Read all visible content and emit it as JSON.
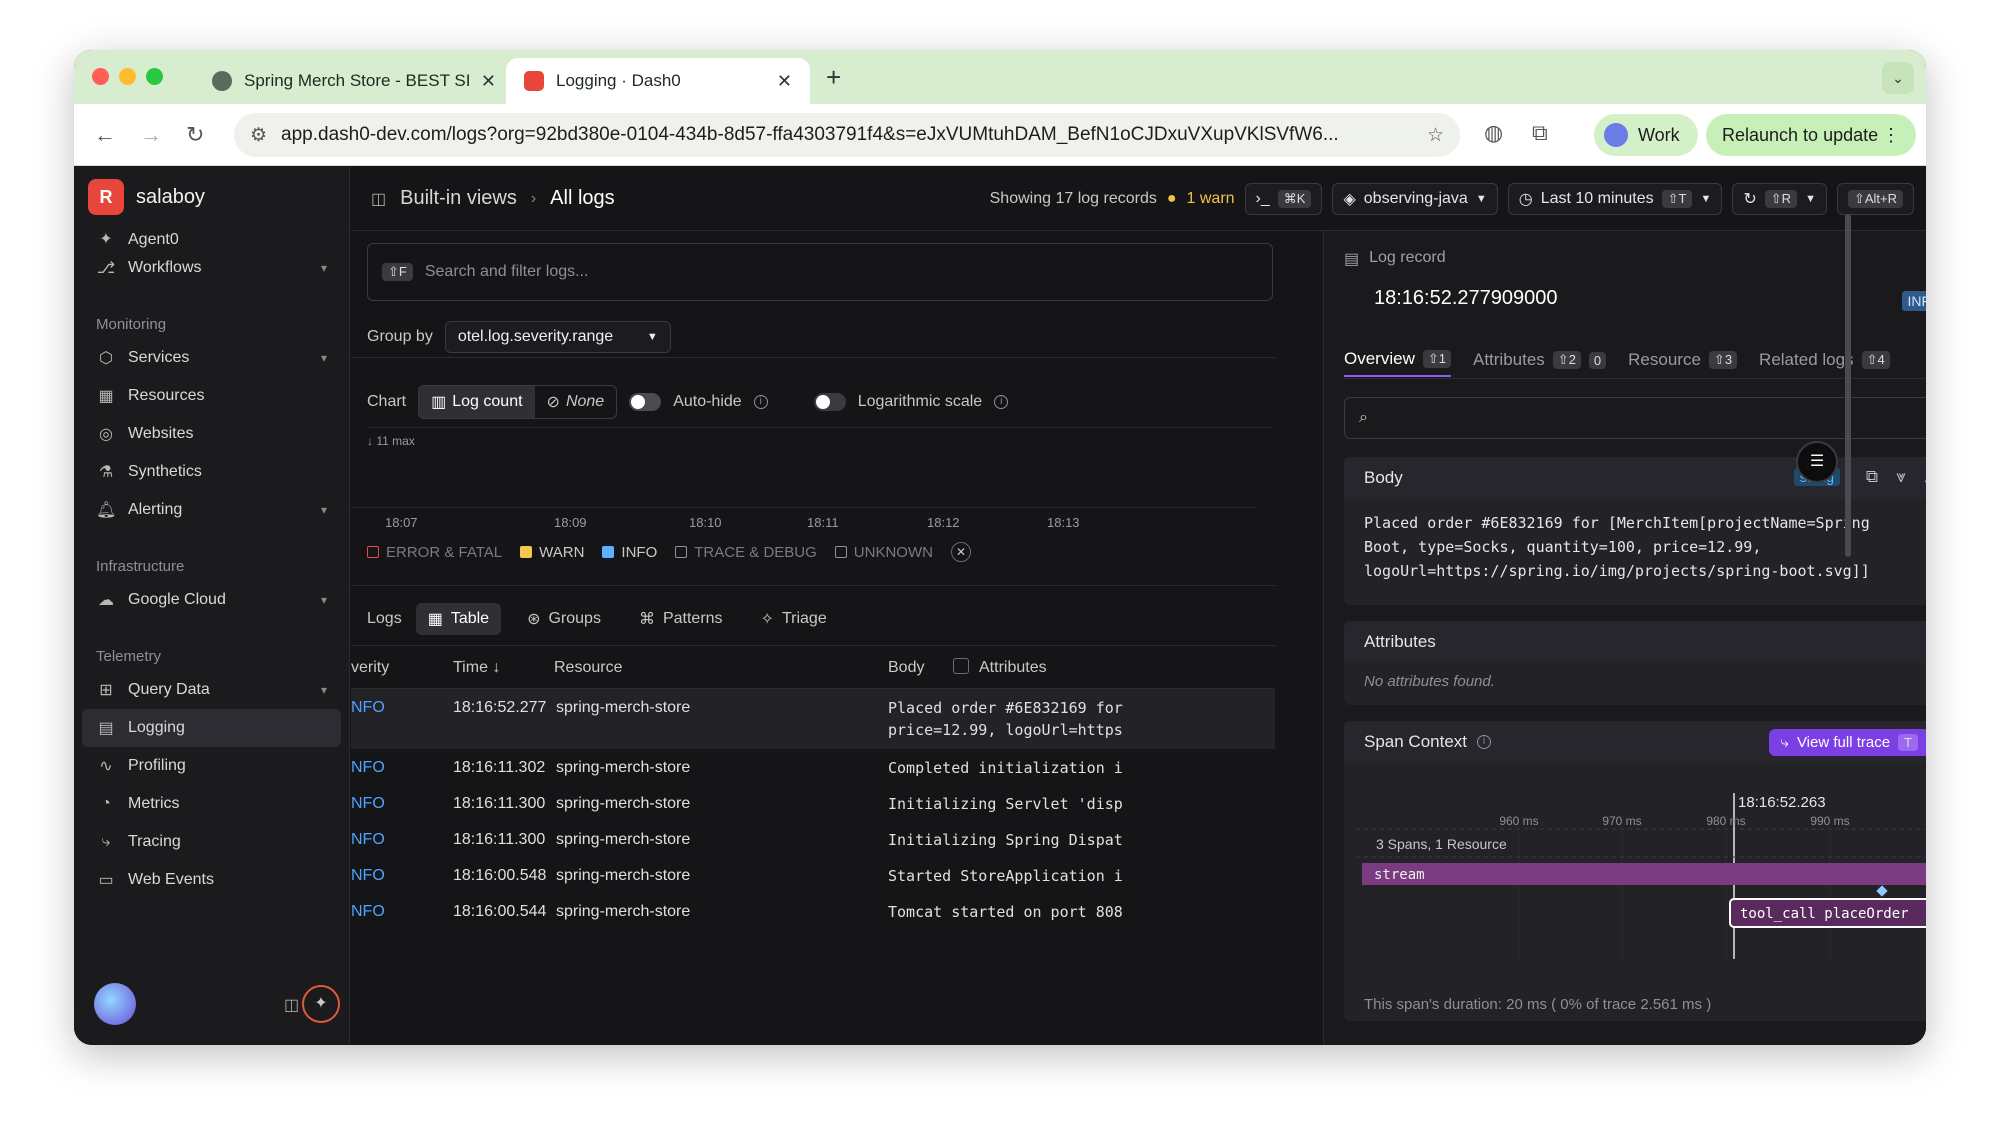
{
  "browser": {
    "tabs": [
      {
        "title": "Spring Merch Store - BEST SI",
        "active": false
      },
      {
        "title": "Logging · Dash0",
        "active": true
      }
    ],
    "new_tab": "+",
    "url": "app.dash0-dev.com/logs?org=92bd380e-0104-434b-8d57-ffa4303791f4&s=eJxVUMtuhDAM_BefN1oCJDxuVXupVKlSVfW6...",
    "profile_label": "Work",
    "relaunch_label": "Relaunch to update"
  },
  "sidebar": {
    "org_name": "salaboy",
    "org_initial": "R",
    "items_top": [
      {
        "label": "Agent0",
        "icon": "agent-icon"
      },
      {
        "label": "Workflows",
        "icon": "workflow-icon",
        "expandable": true
      }
    ],
    "sections": [
      {
        "title": "Monitoring",
        "items": [
          {
            "label": "Services",
            "expandable": true
          },
          {
            "label": "Resources"
          },
          {
            "label": "Websites"
          },
          {
            "label": "Synthetics"
          },
          {
            "label": "Alerting",
            "expandable": true
          }
        ]
      },
      {
        "title": "Infrastructure",
        "items": [
          {
            "label": "Google Cloud",
            "expandable": true
          }
        ]
      },
      {
        "title": "Telemetry",
        "items": [
          {
            "label": "Query Data",
            "expandable": true
          },
          {
            "label": "Logging",
            "active": true
          },
          {
            "label": "Profiling"
          },
          {
            "label": "Metrics"
          },
          {
            "label": "Tracing"
          },
          {
            "label": "Web Events"
          }
        ]
      }
    ]
  },
  "header": {
    "breadcrumb_root": "Built-in views",
    "breadcrumb_current": "All logs",
    "showing": "Showing 17 log records",
    "warn": "1 warn",
    "cmd_kbd": "⌘K",
    "dataset": "observing-java",
    "time_range": "Last 10 minutes",
    "time_kbd": "⇧T",
    "refresh_kbd": "⇧R",
    "alt_kbd": "⇧Alt+R"
  },
  "filters": {
    "search_kbd": "⇧F",
    "search_placeholder": "Search and filter logs...",
    "group_by_label": "Group by",
    "group_by_value": "otel.log.severity.range"
  },
  "chart_controls": {
    "chart_label": "Chart",
    "log_count": "Log count",
    "none": "None",
    "auto_hide": "Auto-hide",
    "log_scale": "Logarithmic scale",
    "max_label": "11 max"
  },
  "chart_data": {
    "type": "bar",
    "x_ticks": [
      "18:07",
      "18:09",
      "18:10",
      "18:11",
      "18:12",
      "18:13"
    ],
    "legend": [
      {
        "label": "ERROR & FATAL",
        "color": "#e5484d",
        "enabled": false
      },
      {
        "label": "WARN",
        "color": "#f2c94c",
        "enabled": true
      },
      {
        "label": "INFO",
        "color": "#5ab2ff",
        "enabled": true
      },
      {
        "label": "TRACE & DEBUG",
        "color": "#8f8f95",
        "enabled": false
      },
      {
        "label": "UNKNOWN",
        "color": "#8f8f95",
        "enabled": false
      }
    ]
  },
  "logs_view": {
    "label": "Logs",
    "options": [
      {
        "label": "Table",
        "active": true
      },
      {
        "label": "Groups"
      },
      {
        "label": "Patterns"
      },
      {
        "label": "Triage"
      }
    ],
    "columns": {
      "severity": "verity",
      "time": "Time ↓",
      "resource": "Resource",
      "body": "Body",
      "attributes": "Attributes"
    },
    "rows": [
      {
        "severity": "NFO",
        "time": "18:16:52.277",
        "resource": "spring-merch-store",
        "body": "Placed order #6E832169 for",
        "body2": "price=12.99, logoUrl=https"
      },
      {
        "severity": "NFO",
        "time": "18:16:11.302",
        "resource": "spring-merch-store",
        "body": "Completed initialization i"
      },
      {
        "severity": "NFO",
        "time": "18:16:11.300",
        "resource": "spring-merch-store",
        "body": "Initializing Servlet 'disp"
      },
      {
        "severity": "NFO",
        "time": "18:16:11.300",
        "resource": "spring-merch-store",
        "body": "Initializing Spring Dispat"
      },
      {
        "severity": "NFO",
        "time": "18:16:00.548",
        "resource": "spring-merch-store",
        "body": "Started StoreApplication i"
      },
      {
        "severity": "NFO",
        "time": "18:16:00.544",
        "resource": "spring-merch-store",
        "body": "Tomcat started on port 808"
      }
    ]
  },
  "panel": {
    "title": "Log record",
    "timestamp": "18:16:52.277909000",
    "severity": "INFO",
    "tabs": [
      {
        "label": "Overview",
        "count": "⇧1",
        "active": true
      },
      {
        "label": "Attributes",
        "count": "⇧2",
        "extra": "0"
      },
      {
        "label": "Resource",
        "count": "⇧3"
      },
      {
        "label": "Related logs",
        "count": "⇧4"
      }
    ],
    "body_title": "Body",
    "body_type": "string",
    "body_lines": [
      "Placed order #6E832169 for [MerchItem[projectName=Spring",
      "Boot, type=Socks, quantity=100, price=12.99,",
      "logoUrl=https://spring.io/img/projects/spring-boot.svg]]"
    ],
    "attributes_title": "Attributes",
    "no_attributes": "No attributes found.",
    "span_title": "Span Context",
    "view_trace": "View full trace",
    "view_trace_kbd": "T",
    "span_time": "18:16:52.263",
    "span_ticks": [
      "960 ms",
      "970 ms",
      "980 ms",
      "990 ms"
    ],
    "span_summary": "3 Spans, 1 Resource",
    "span_stream": "stream",
    "span_tool": "tool_call placeOrder",
    "span_duration": "This span's duration: 20 ms ( 0% of trace 2.561 ms )"
  }
}
